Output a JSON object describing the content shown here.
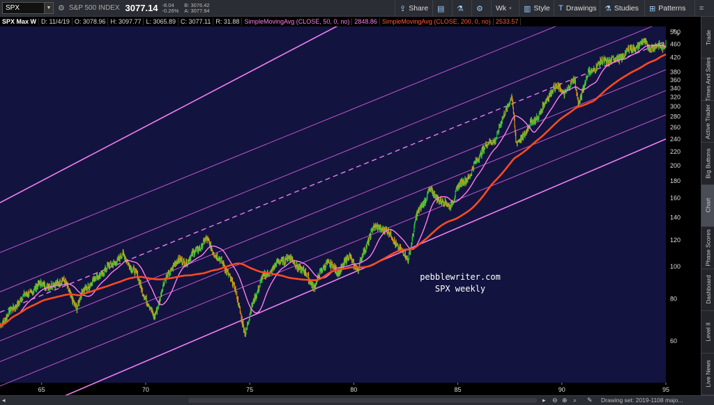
{
  "toolbar": {
    "symbol": "SPX",
    "index_name": "S&P 500 INDEX",
    "last": "3077.14",
    "change": "-8.04",
    "change_pct": "-0.26%",
    "bid": "B: 3076.42",
    "ask": "A: 3077.94",
    "share_label": "Share",
    "wk_label": "Wk",
    "style_label": "Style",
    "drawings_label": "Drawings",
    "studies_label": "Studies",
    "patterns_label": "Patterns"
  },
  "info": {
    "symbol": "SPX Max W",
    "date": "D: 11/4/19",
    "open": "O: 3078.96",
    "high": "H: 3097.77",
    "low": "L: 3065.89",
    "close": "C: 3077.11",
    "range": "R: 31.88",
    "sma50_label": "SimpleMovingAvg (CLOSE, 50, 0, no)",
    "sma50_value": "2848.86",
    "sma200_label": "SimpleMovingAvg (CLOSE, 200, 0, no)",
    "sma200_value": "2533.57"
  },
  "annotation": {
    "line1": "pebblewriter.com",
    "line2": "SPX weekly"
  },
  "right_tabs": [
    "Trade",
    "Times And Sales",
    "Active Trader",
    "Big Buttons",
    "Chart",
    "Phase Scores",
    "Dashboard",
    "Level II",
    "Live News"
  ],
  "active_tab": "Chart",
  "bottom": {
    "drawing_set": "Drawing set: 2019-1108 majo..."
  },
  "chart_data": {
    "type": "line",
    "yscale": "log",
    "ylim": [
      45,
      520
    ],
    "xlim": [
      1963,
      1995
    ],
    "x_ticks": [
      65,
      70,
      75,
      80,
      85,
      90,
      95
    ],
    "y_ticks": [
      60,
      80,
      100,
      120,
      140,
      160,
      180,
      200,
      220,
      240,
      260,
      280,
      300,
      320,
      340,
      360,
      380,
      420,
      460,
      500
    ],
    "series": [
      {
        "name": "SimpleMovingAvg (CLOSE, 50, 0, no)",
        "color": "#ff7ff0"
      },
      {
        "name": "SimpleMovingAvg (CLOSE, 200, 0, no)",
        "color": "#ff4a20"
      }
    ],
    "price_points": [
      [
        1963.0,
        67
      ],
      [
        1964.0,
        80
      ],
      [
        1965.0,
        89
      ],
      [
        1965.5,
        87
      ],
      [
        1966.0,
        92
      ],
      [
        1966.7,
        75
      ],
      [
        1967.0,
        85
      ],
      [
        1968.0,
        97
      ],
      [
        1968.9,
        108
      ],
      [
        1969.5,
        96
      ],
      [
        1970.4,
        70
      ],
      [
        1970.9,
        90
      ],
      [
        1971.4,
        103
      ],
      [
        1972.0,
        104
      ],
      [
        1972.9,
        120
      ],
      [
        1973.5,
        106
      ],
      [
        1974.0,
        95
      ],
      [
        1974.3,
        85
      ],
      [
        1974.8,
        63
      ],
      [
        1975.2,
        80
      ],
      [
        1975.6,
        92
      ],
      [
        1976.2,
        100
      ],
      [
        1976.8,
        107
      ],
      [
        1977.5,
        98
      ],
      [
        1978.1,
        87
      ],
      [
        1978.7,
        104
      ],
      [
        1979.2,
        96
      ],
      [
        1979.8,
        107
      ],
      [
        1980.2,
        98
      ],
      [
        1980.9,
        130
      ],
      [
        1981.5,
        130
      ],
      [
        1982.0,
        118
      ],
      [
        1982.6,
        104
      ],
      [
        1983.0,
        140
      ],
      [
        1983.6,
        168
      ],
      [
        1984.2,
        158
      ],
      [
        1984.6,
        150
      ],
      [
        1985.0,
        172
      ],
      [
        1985.6,
        188
      ],
      [
        1986.2,
        225
      ],
      [
        1986.8,
        240
      ],
      [
        1987.3,
        290
      ],
      [
        1987.6,
        328
      ],
      [
        1987.8,
        230
      ],
      [
        1988.5,
        265
      ],
      [
        1989.0,
        290
      ],
      [
        1989.6,
        345
      ],
      [
        1990.1,
        330
      ],
      [
        1990.6,
        360
      ],
      [
        1990.8,
        308
      ],
      [
        1991.3,
        380
      ],
      [
        1992.0,
        410
      ],
      [
        1992.7,
        415
      ],
      [
        1993.2,
        440
      ],
      [
        1993.9,
        465
      ],
      [
        1994.4,
        450
      ],
      [
        1994.9,
        455
      ],
      [
        1995.0,
        470
      ]
    ],
    "channel_lines": [
      {
        "kind": "upper-solid",
        "y1963": 155,
        "y1995": 1700
      },
      {
        "kind": "dashed",
        "y1963": 73,
        "y1995": 470
      },
      {
        "kind": "lower-solid",
        "y1963": 34,
        "y1995": 240
      },
      {
        "kind": "thin",
        "y1963": 110
      },
      {
        "kind": "thin",
        "y1963": 84
      },
      {
        "kind": "thin",
        "y1963": 60
      },
      {
        "kind": "thin",
        "y1963": 52
      },
      {
        "kind": "thin",
        "y1963": 44
      }
    ]
  }
}
